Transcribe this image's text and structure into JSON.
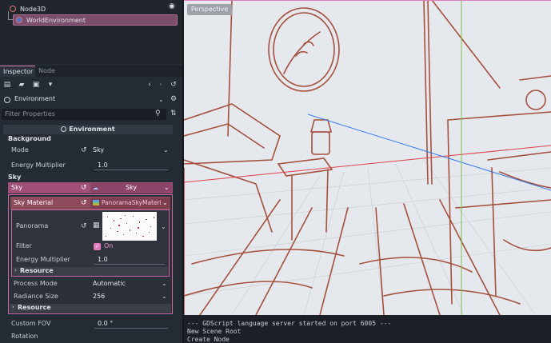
{
  "scene_tree": {
    "root": {
      "label": "Node3D"
    },
    "child": {
      "label": "WorldEnvironment"
    }
  },
  "inspector": {
    "tabs": [
      {
        "label": "Inspector"
      },
      {
        "label": "Node"
      }
    ],
    "resource_type": "Environment",
    "filter_placeholder": "Filter Properties",
    "header": "Environment",
    "background": {
      "section": "Background",
      "mode_label": "Mode",
      "mode_value": "Sky",
      "energy_label": "Energy Multiplier",
      "energy_value": "1.0"
    },
    "sky": {
      "section": "Sky",
      "sky_label": "Sky",
      "sky_value": "Sky",
      "material_label": "Sky Material",
      "material_value": "PanoramaSkyMateri",
      "panorama_label": "Panorama",
      "filter_label": "Filter",
      "filter_value": "On",
      "filter_checked": true,
      "energy_label": "Energy Multiplier",
      "energy_value": "1.0",
      "resource_inner": "Resource",
      "process_label": "Process Mode",
      "process_value": "Automatic",
      "radiance_label": "Radiance Size",
      "radiance_value": "256",
      "resource_outer": "Resource"
    },
    "custom_fov_label": "Custom FOV",
    "custom_fov_value": "0.0 °",
    "rotation_label": "Rotation"
  },
  "viewport": {
    "label": "Perspective"
  },
  "output": {
    "lines": [
      "--- GDScript language server started on port 6005 ---",
      "New Scene Root",
      "Create Node"
    ]
  },
  "colors": {
    "accent_pink": "#e07bbd",
    "sky_row": "#a04f78",
    "material_row": "#8f4b5e",
    "selected_node": "#7a4e6a",
    "axis_blue": "#3a7ef0",
    "axis_red": "#e0404a",
    "axis_green": "#7ec24a",
    "sketch": "#a5503d"
  }
}
